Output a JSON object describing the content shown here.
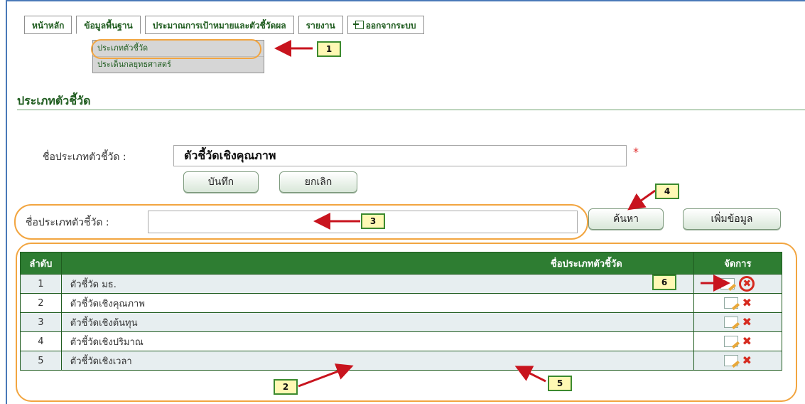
{
  "menu": {
    "items": [
      "หน้าหลัก",
      "ข้อมูลพื้นฐาน",
      "ประมาณการเป้าหมายและตัวชี้วัดผล",
      "รายงาน",
      "ออกจากระบบ"
    ]
  },
  "submenu": {
    "items": [
      "ประเภทตัวชี้วัด",
      "ประเด็นกลยุทธศาสตร์"
    ]
  },
  "page_title": "ประเภทตัวชี้วัด",
  "form": {
    "label": "ชื่อประเภทตัวชี้วัด :",
    "value": "ตัวชี้วัดเชิงคุณภาพ",
    "required_mark": "*",
    "save_label": "บันทึก",
    "cancel_label": "ยกเลิก"
  },
  "search": {
    "label": "ชื่อประเภทตัวชี้วัด :",
    "value": "",
    "search_label": "ค้นหา",
    "add_label": "เพิ่มข้อมูล"
  },
  "table": {
    "headers": [
      "ลำดับ",
      "ชื่อประเภทตัวชี้วัด",
      "จัดการ"
    ],
    "rows": [
      {
        "no": "1",
        "name": "ตัวชี้วัด มธ."
      },
      {
        "no": "2",
        "name": "ตัวชี้วัดเชิงคุณภาพ"
      },
      {
        "no": "3",
        "name": "ตัวชี้วัดเชิงต้นทุน"
      },
      {
        "no": "4",
        "name": "ตัวชี้วัดเชิงปริมาณ"
      },
      {
        "no": "5",
        "name": "ตัวชี้วัดเชิงเวลา"
      }
    ]
  },
  "callouts": [
    "1",
    "2",
    "3",
    "4",
    "5",
    "6"
  ],
  "colors": {
    "menu_text": "#1f5c1f",
    "table_header": "#2e7d32",
    "callout_border": "#3c8a2f",
    "callout_fill": "#fff8b4",
    "highlight_oval": "#f2a540",
    "arrow": "#c8141e",
    "delete": "#d62a1f"
  }
}
